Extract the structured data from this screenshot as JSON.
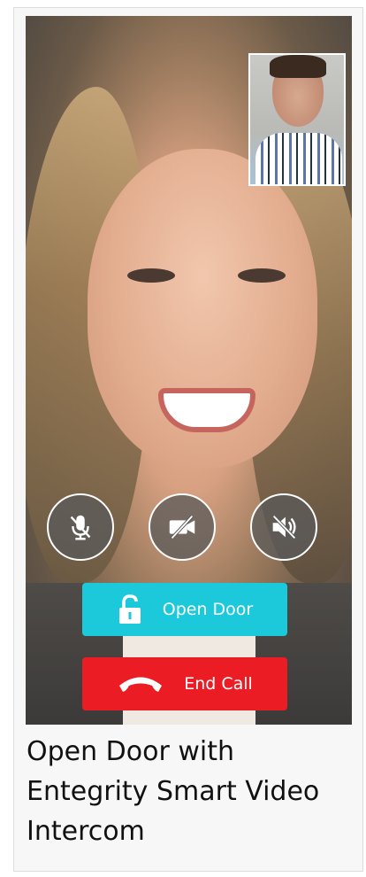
{
  "open_door_label": "Open Door",
  "end_call_label": "End Call",
  "caption": "Open Door with Entegrity Smart Video Intercom",
  "controls": {
    "mute_icon": "microphone-muted-icon",
    "video_icon": "video-off-icon",
    "speaker_icon": "speaker-muted-icon"
  },
  "colors": {
    "open_door": "#1cc9da",
    "end_call": "#ec1c24"
  }
}
